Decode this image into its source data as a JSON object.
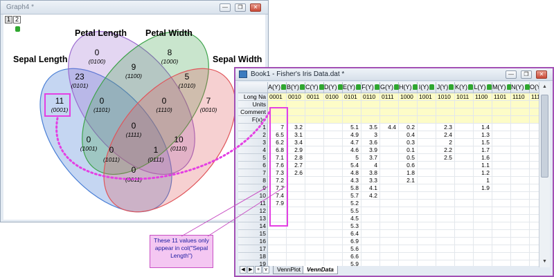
{
  "graph_window": {
    "title": "Graph4 *",
    "layer_tabs": [
      "1",
      "2"
    ],
    "set_labels": {
      "sepal_length": "Sepal Length",
      "petal_length": "Petal Length",
      "petal_width": "Petal Width",
      "sepal_width": "Sepal Width"
    },
    "regions": [
      {
        "id": "r0100",
        "count": "0",
        "code": "(0100)"
      },
      {
        "id": "r1000",
        "count": "8",
        "code": "(1000)"
      },
      {
        "id": "r1100",
        "count": "9",
        "code": "(1100)"
      },
      {
        "id": "r0101",
        "count": "23",
        "code": "(0101)"
      },
      {
        "id": "r1010",
        "count": "5",
        "code": "(1010)"
      },
      {
        "id": "r0010",
        "count": "7",
        "code": "(0010)"
      },
      {
        "id": "r0001",
        "count": "11",
        "code": "(0001)"
      },
      {
        "id": "r1101",
        "count": "0",
        "code": "(1101)"
      },
      {
        "id": "r1110",
        "count": "0",
        "code": "(1110)"
      },
      {
        "id": "r1111",
        "count": "0",
        "code": "(1111)"
      },
      {
        "id": "r1001",
        "count": "0",
        "code": "(1001)"
      },
      {
        "id": "r0110",
        "count": "10",
        "code": "(0110)"
      },
      {
        "id": "r1011",
        "count": "0",
        "code": "(1011)"
      },
      {
        "id": "r0111",
        "count": "1",
        "code": "(0111)"
      },
      {
        "id": "r0011",
        "count": "0",
        "code": "(0011)"
      }
    ],
    "colors": {
      "sepal_length": "#4a7fd6",
      "petal_length": "#9b6bd0",
      "petal_width": "#3ea34b",
      "sepal_width": "#e0555a",
      "highlight": "#e43fe3"
    }
  },
  "book_window": {
    "title": "Book1 - Fisher's Iris Data.dat *",
    "columns": [
      {
        "name": "A(Y)",
        "long_name": "0001"
      },
      {
        "name": "B(Y)",
        "long_name": "0010"
      },
      {
        "name": "C(Y)",
        "long_name": "0011"
      },
      {
        "name": "D(Y)",
        "long_name": "0100"
      },
      {
        "name": "E(Y)",
        "long_name": "0101"
      },
      {
        "name": "F(Y)",
        "long_name": "0110"
      },
      {
        "name": "G(Y)",
        "long_name": "0111"
      },
      {
        "name": "H(Y)",
        "long_name": "1000"
      },
      {
        "name": "I(Y)",
        "long_name": "1001"
      },
      {
        "name": "J(Y)",
        "long_name": "1010"
      },
      {
        "name": "K(Y)",
        "long_name": "1011"
      },
      {
        "name": "L(Y)",
        "long_name": "1100"
      },
      {
        "name": "M(Y)",
        "long_name": "1101"
      },
      {
        "name": "N(Y)",
        "long_name": "1110"
      },
      {
        "name": "O(Y)",
        "long_name": "1111"
      }
    ],
    "meta_rows": [
      "Long Na",
      "Units",
      "Comment",
      "F(x)="
    ],
    "rows": [
      {
        "label": "1",
        "cells": [
          "7",
          "3.2",
          "",
          "",
          "5.1",
          "3.5",
          "4.4",
          "0.2",
          "",
          "2.3",
          "",
          "1.4",
          "",
          "",
          ""
        ]
      },
      {
        "label": "2",
        "cells": [
          "6.5",
          "3.1",
          "",
          "",
          "4.9",
          "3",
          "",
          "0.4",
          "",
          "2.4",
          "",
          "1.3",
          "",
          "",
          ""
        ]
      },
      {
        "label": "3",
        "cells": [
          "6.2",
          "3.4",
          "",
          "",
          "4.7",
          "3.6",
          "",
          "0.3",
          "",
          "2",
          "",
          "1.5",
          "",
          "",
          ""
        ]
      },
      {
        "label": "4",
        "cells": [
          "6.8",
          "2.9",
          "",
          "",
          "4.6",
          "3.9",
          "",
          "0.1",
          "",
          "2.2",
          "",
          "1.7",
          "",
          "",
          ""
        ]
      },
      {
        "label": "5",
        "cells": [
          "7.1",
          "2.8",
          "",
          "",
          "5",
          "3.7",
          "",
          "0.5",
          "",
          "2.5",
          "",
          "1.6",
          "",
          "",
          ""
        ]
      },
      {
        "label": "6",
        "cells": [
          "7.6",
          "2.7",
          "",
          "",
          "5.4",
          "4",
          "",
          "0.6",
          "",
          "",
          "",
          "1.1",
          "",
          "",
          ""
        ]
      },
      {
        "label": "7",
        "cells": [
          "7.3",
          "2.6",
          "",
          "",
          "4.8",
          "3.8",
          "",
          "1.8",
          "",
          "",
          "",
          "1.2",
          "",
          "",
          ""
        ]
      },
      {
        "label": "8",
        "cells": [
          "7.2",
          "",
          "",
          "",
          "4.3",
          "3.3",
          "",
          "2.1",
          "",
          "",
          "",
          "1",
          "",
          "",
          ""
        ]
      },
      {
        "label": "9",
        "cells": [
          "7.7",
          "",
          "",
          "",
          "5.8",
          "4.1",
          "",
          "",
          "",
          "",
          "",
          "1.9",
          "",
          "",
          ""
        ]
      },
      {
        "label": "10",
        "cells": [
          "7.4",
          "",
          "",
          "",
          "5.7",
          "4.2",
          "",
          "",
          "",
          "",
          "",
          "",
          "",
          "",
          ""
        ]
      },
      {
        "label": "11",
        "cells": [
          "7.9",
          "",
          "",
          "",
          "5.2",
          "",
          "",
          "",
          "",
          "",
          "",
          "",
          "",
          "",
          ""
        ]
      },
      {
        "label": "12",
        "cells": [
          "",
          "",
          "",
          "",
          "5.5",
          "",
          "",
          "",
          "",
          "",
          "",
          "",
          "",
          "",
          ""
        ]
      },
      {
        "label": "13",
        "cells": [
          "",
          "",
          "",
          "",
          "4.5",
          "",
          "",
          "",
          "",
          "",
          "",
          "",
          "",
          "",
          ""
        ]
      },
      {
        "label": "14",
        "cells": [
          "",
          "",
          "",
          "",
          "5.3",
          "",
          "",
          "",
          "",
          "",
          "",
          "",
          "",
          "",
          ""
        ]
      },
      {
        "label": "15",
        "cells": [
          "",
          "",
          "",
          "",
          "6.4",
          "",
          "",
          "",
          "",
          "",
          "",
          "",
          "",
          "",
          ""
        ]
      },
      {
        "label": "16",
        "cells": [
          "",
          "",
          "",
          "",
          "6.9",
          "",
          "",
          "",
          "",
          "",
          "",
          "",
          "",
          "",
          ""
        ]
      },
      {
        "label": "17",
        "cells": [
          "",
          "",
          "",
          "",
          "5.6",
          "",
          "",
          "",
          "",
          "",
          "",
          "",
          "",
          "",
          ""
        ]
      },
      {
        "label": "18",
        "cells": [
          "",
          "",
          "",
          "",
          "6.6",
          "",
          "",
          "",
          "",
          "",
          "",
          "",
          "",
          "",
          ""
        ]
      },
      {
        "label": "19",
        "cells": [
          "",
          "",
          "",
          "",
          "5.9",
          "",
          "",
          "",
          "",
          "",
          "",
          "",
          "",
          "",
          ""
        ]
      }
    ],
    "sheet_tabs": [
      "VennPlot",
      "VennData"
    ],
    "active_sheet": "VennData"
  },
  "callout": {
    "text": "These 11 values only appear in col(\"Sepal Length\")"
  }
}
